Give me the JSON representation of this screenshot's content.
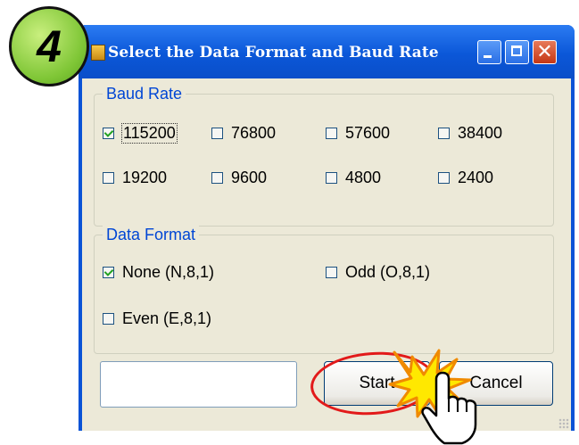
{
  "window": {
    "title": "Select the Data Format and Baud Rate",
    "buttons": {
      "minimize": "minimize-icon",
      "maximize": "maximize-icon",
      "close": "close-icon"
    }
  },
  "step_badge": "4",
  "baud_rate": {
    "legend": "Baud Rate",
    "options": [
      {
        "label": "115200",
        "checked": true
      },
      {
        "label": "76800",
        "checked": false
      },
      {
        "label": "57600",
        "checked": false
      },
      {
        "label": "38400",
        "checked": false
      },
      {
        "label": "19200",
        "checked": false
      },
      {
        "label": "9600",
        "checked": false
      },
      {
        "label": "4800",
        "checked": false
      },
      {
        "label": "2400",
        "checked": false
      }
    ]
  },
  "data_format": {
    "legend": "Data Format",
    "options": [
      {
        "label": "None (N,8,1)",
        "checked": true
      },
      {
        "label": "Odd (O,8,1)",
        "checked": false
      },
      {
        "label": "Even (E,8,1)",
        "checked": false
      }
    ]
  },
  "bottom": {
    "text_field_value": "",
    "start_label": "Start",
    "cancel_label": "Cancel"
  },
  "colors": {
    "accent_blue": "#0a53d6",
    "highlight_red": "#e21a1a",
    "group_text": "#0046d5"
  }
}
